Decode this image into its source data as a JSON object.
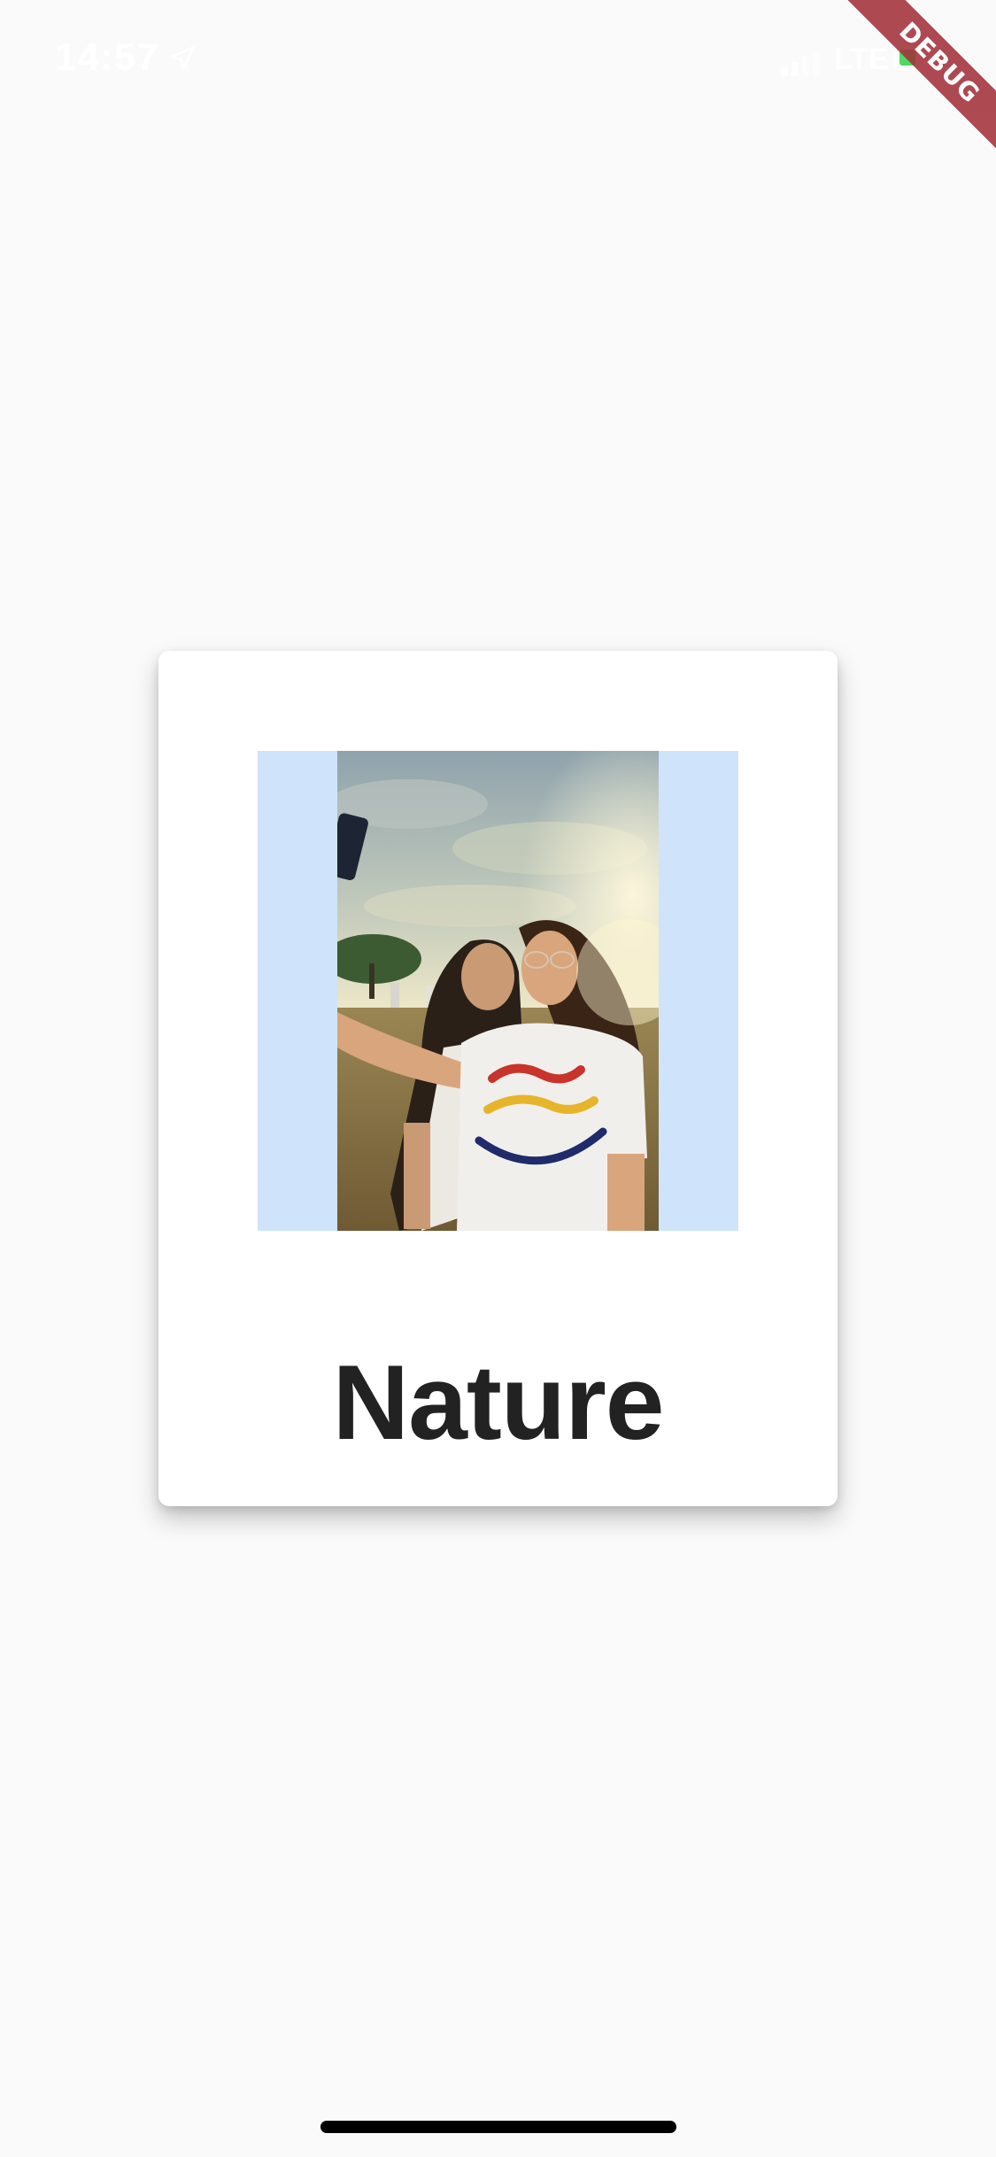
{
  "status_bar": {
    "time": "14:57",
    "network": "LTE",
    "location_icon": "location-arrow-icon",
    "signal_icon": "cellular-signal-icon",
    "battery_icon": "battery-icon",
    "battery_color": "#4cd964"
  },
  "debug_banner": {
    "label": "DEBUG",
    "color": "#a3313a"
  },
  "card": {
    "title": "Nature",
    "image_background": "#cfe4fa",
    "image_alt": "Two women taking a selfie outdoors at sunset"
  },
  "home_indicator": {
    "icon": "home-indicator-bar"
  }
}
